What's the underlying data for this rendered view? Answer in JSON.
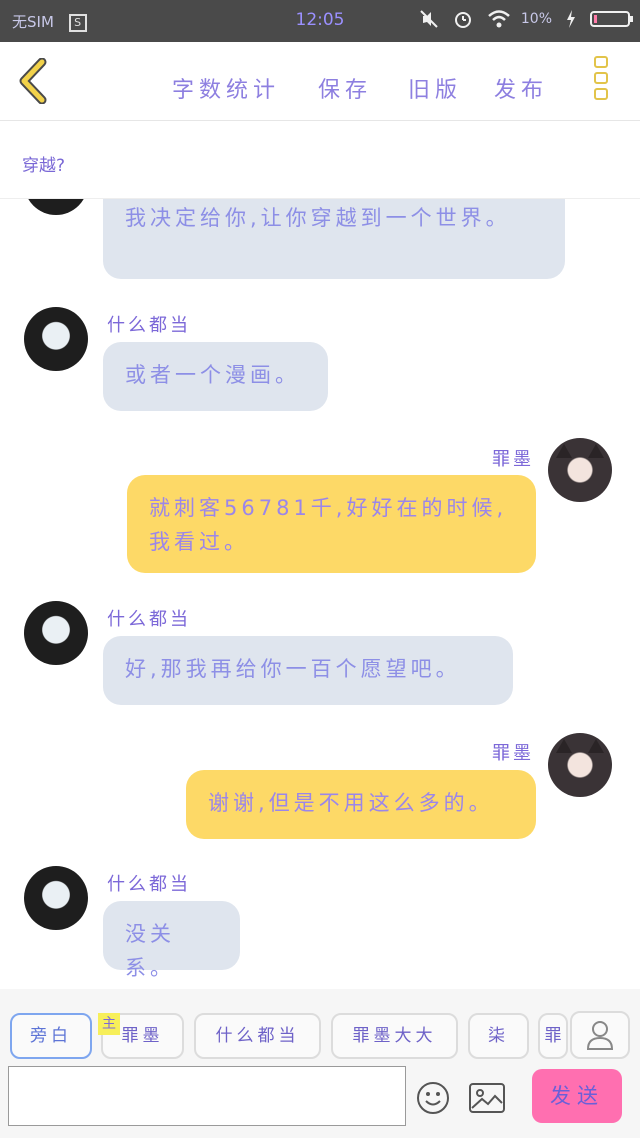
{
  "status_bar": {
    "sim": "无SIM",
    "s_badge": "S",
    "time": "12:05",
    "battery_pct": "10%",
    "battery_level": 0.1
  },
  "toolbar": {
    "word_count": "字数统计",
    "save": "保存",
    "old_version": "旧版",
    "publish": "发布"
  },
  "chat": {
    "title": "穿越?",
    "messages": [
      {
        "side": "left",
        "text": "我决定给你,让你穿越到一个世界。"
      },
      {
        "side": "left",
        "sender": "什么都当",
        "text": "或者一个漫画。"
      },
      {
        "side": "right",
        "sender": "罪墨",
        "text": "就刺客56781千,好好在的时候,我看过。"
      },
      {
        "side": "left",
        "sender": "什么都当",
        "text": "好,那我再给你一百个愿望吧。"
      },
      {
        "side": "right",
        "sender": "罪墨",
        "text": "谢谢,但是不用这么多的。"
      },
      {
        "side": "left",
        "sender": "什么都当",
        "text": "没关系。"
      }
    ]
  },
  "input_bar": {
    "roles": [
      "旁白",
      "罪墨",
      "什么都当",
      "罪墨大大",
      "柒",
      "罪"
    ],
    "host_badge": "主",
    "placeholder": "",
    "send": "发送"
  },
  "colors": {
    "accent_purple": "#8d7fe0",
    "left_bubble": "#dfe5ee",
    "right_bubble": "#fdd967",
    "send_button": "#ff6fb0",
    "menu_yellow": "#e2c44a"
  }
}
